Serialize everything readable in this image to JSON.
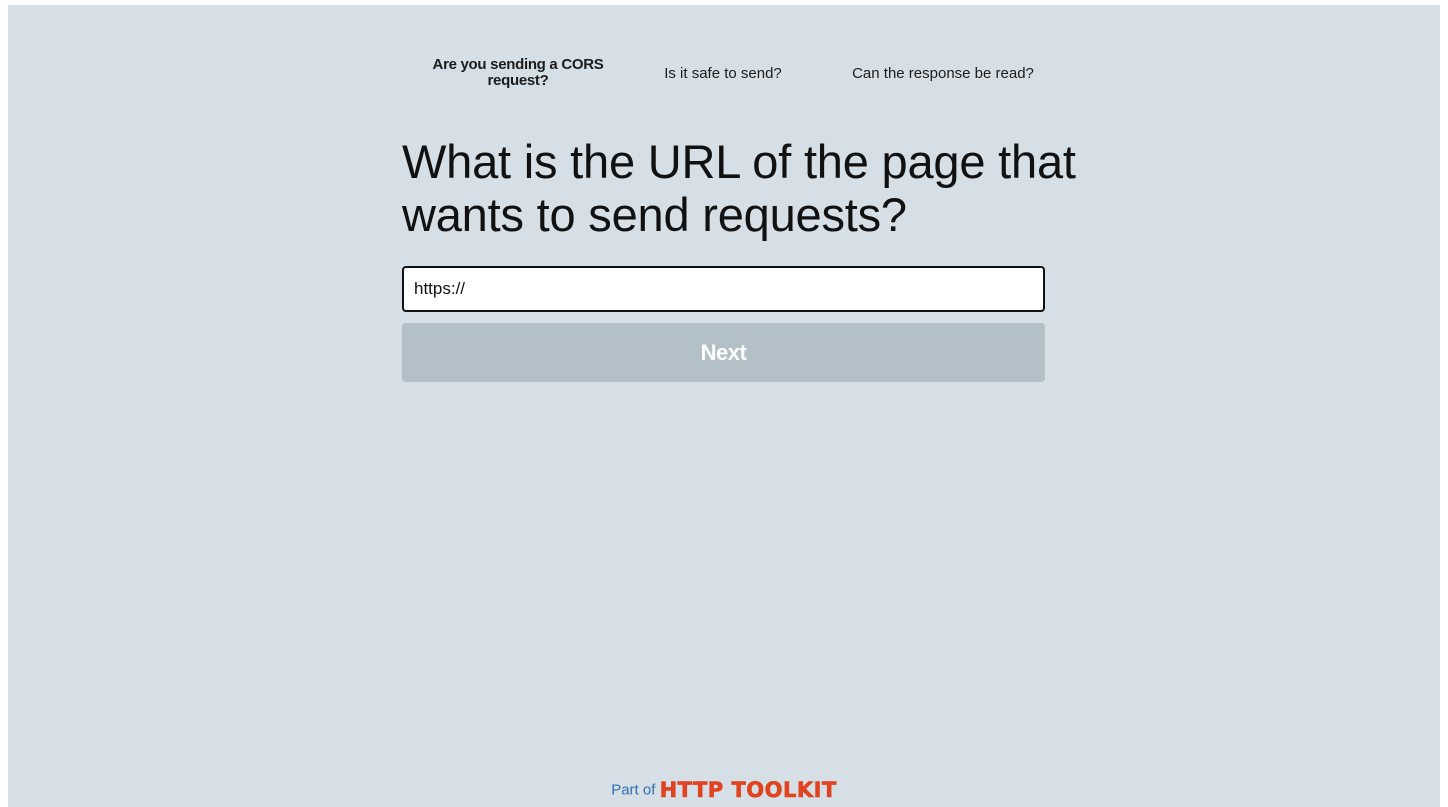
{
  "steps": [
    {
      "label": "Are you sending a CORS request?",
      "active": true
    },
    {
      "label": "Is it safe to send?",
      "active": false
    },
    {
      "label": "Can the response be read?",
      "active": false
    }
  ],
  "question": {
    "title": "What is the URL of the page that wants to send requests?"
  },
  "url_input": {
    "value": "https://"
  },
  "next_button": {
    "label": "Next"
  },
  "footer": {
    "prefix": "Part of",
    "brand": "HTTP TOOLKIT"
  },
  "colors": {
    "background": "#d6dfe5",
    "button_disabled": "#b3c0c7",
    "link_blue": "#2e6fb5",
    "brand_red": "#e1421f"
  }
}
